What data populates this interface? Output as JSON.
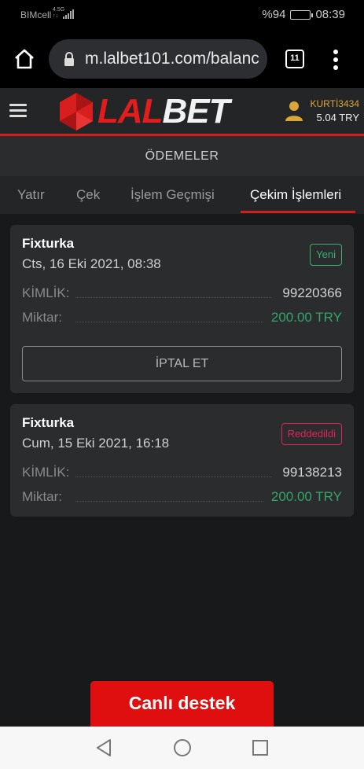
{
  "statusbar": {
    "carrier": "BIMcell",
    "network_top": "4.5G",
    "network_bottom": "↑↓",
    "battery_text": "%94",
    "time": "08:39",
    "battery_level": 0.94
  },
  "browser": {
    "url": "m.lalbet101.com/balanc",
    "tab_count": "11"
  },
  "header": {
    "logo_part1": "LAL",
    "logo_part2": "BET",
    "username": "KURTİ3434",
    "balance": "5.04 TRY",
    "brand_color": "#e21d1d"
  },
  "page": {
    "title": "ÖDEMELER"
  },
  "tabs": [
    {
      "label": "Yatır"
    },
    {
      "label": "Çek"
    },
    {
      "label": "İşlem Geçmişi"
    },
    {
      "label": "Çekim İşlemleri",
      "active": true
    }
  ],
  "withdrawals": [
    {
      "method": "Fixturka",
      "date": "Cts, 16 Eki 2021, 08:38",
      "status": "Yeni",
      "status_color": "#3bb06e",
      "id_label": "KİMLİK:",
      "id_value": "99220366",
      "amount_label": "Miktar:",
      "amount_value": "200.00 TRY",
      "cancel_label": "İPTAL ET"
    },
    {
      "method": "Fixturka",
      "date": "Cum, 15 Eki 2021, 16:18",
      "status": "Reddedildi",
      "status_color": "#e0235a",
      "id_label": "KİMLİK:",
      "id_value": "99138213",
      "amount_label": "Miktar:",
      "amount_value": "200.00 TRY"
    }
  ],
  "support": {
    "label": "Canlı destek"
  },
  "icons": {
    "home": "home-icon",
    "lock": "lock-icon",
    "tabs": "tabs-icon",
    "menu": "more-vert-icon",
    "hamburger": "hamburger-icon",
    "user": "user-icon",
    "back": "back-triangle-icon",
    "nav_home": "circle-home-icon",
    "recent": "square-recent-icon"
  }
}
